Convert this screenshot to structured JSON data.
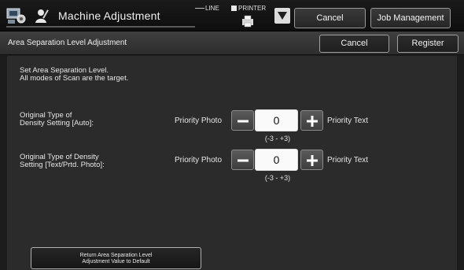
{
  "header": {
    "title": "Machine Adjustment",
    "line_label": "LINE",
    "printer_label": "PRINTER",
    "cancel_label": "Cancel",
    "job_management_label": "Job Management"
  },
  "subheader": {
    "title": "Area Separation Level Adjustment",
    "cancel_label": "Cancel",
    "register_label": "Register"
  },
  "instructions": {
    "line1": "Set Area Separation Level.",
    "line2": "All modes of Scan are the target."
  },
  "settings": [
    {
      "label_line1": "Original Type of",
      "label_line2": "Density Setting [Auto]:",
      "left_label": "Priority Photo",
      "value": "0",
      "right_label": "Priority Text",
      "range": "(-3 - +3)"
    },
    {
      "label_line1": "Original Type of Density",
      "label_line2": "Setting [Text/Prtd. Photo]:",
      "left_label": "Priority Photo",
      "value": "0",
      "right_label": "Priority Text",
      "range": "(-3 - +3)"
    }
  ],
  "footer": {
    "reset_line1": "Return Area Separation Level",
    "reset_line2": "Adjustment Value to Default"
  },
  "icons": {
    "app": "machine-adjustment-icon",
    "user": "operator-icon",
    "printer": "printer-icon",
    "dropdown": "triangle-down-icon",
    "minus": "minus-icon",
    "plus": "plus-icon"
  },
  "colors": {
    "background": "#1c1c1c",
    "panel": "#2b2b2b",
    "value_box": "#fafafa",
    "button_border": "#9a9a9a"
  }
}
